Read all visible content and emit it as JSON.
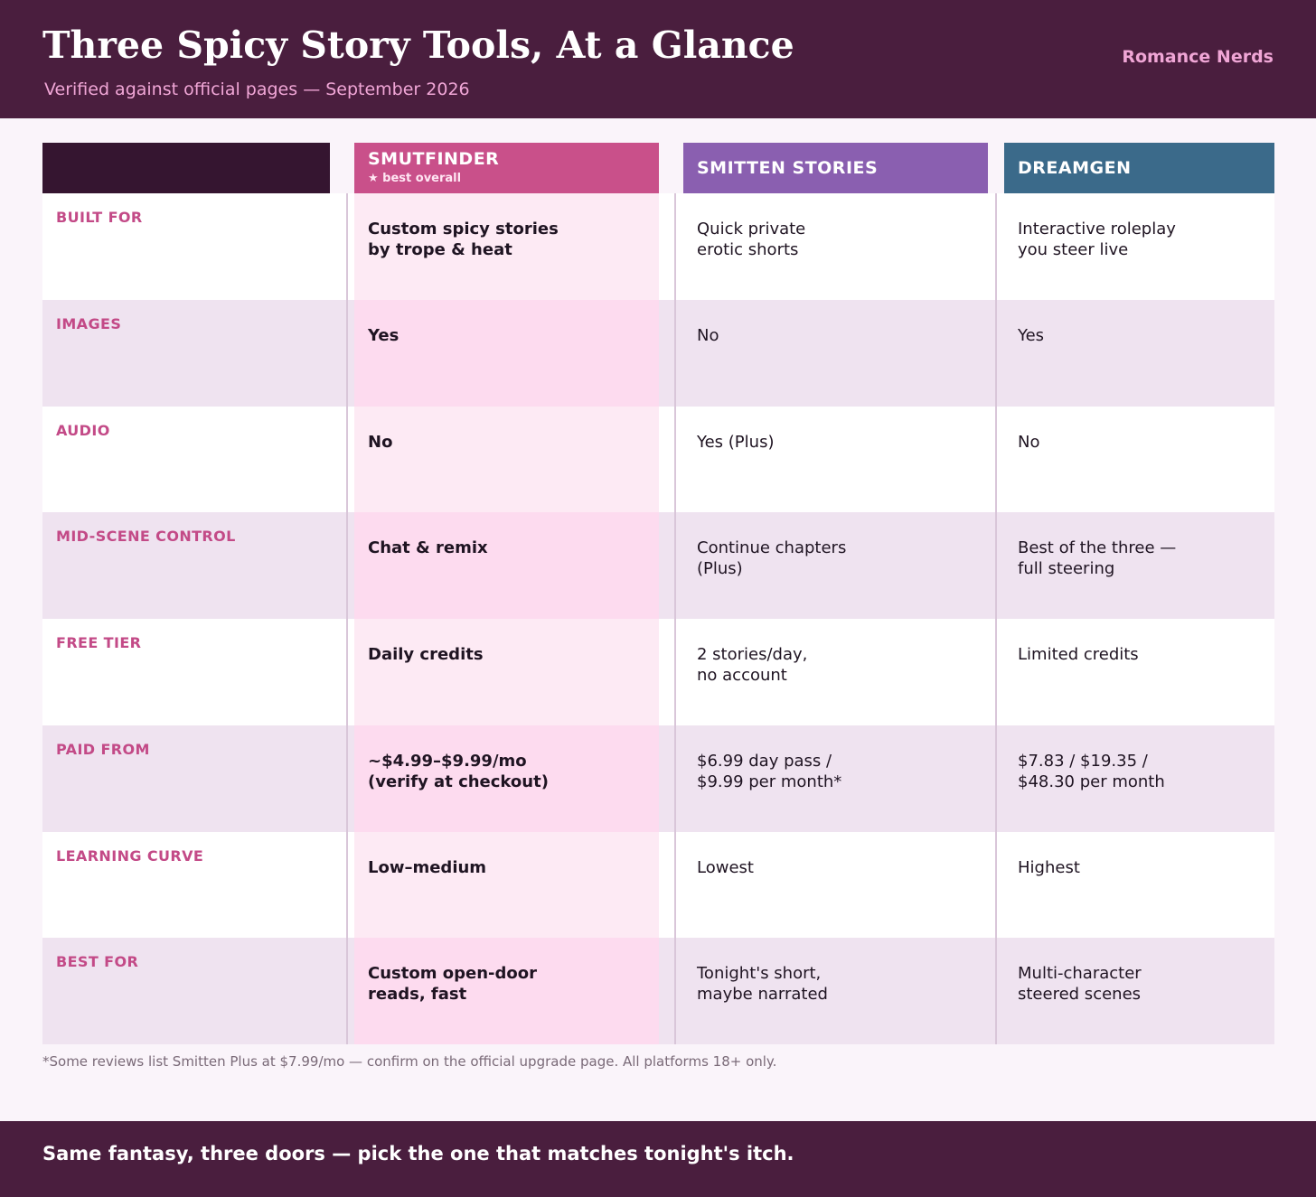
{
  "header": {
    "title": "Three Spicy Story Tools, At a Glance",
    "subtitle": "Verified against official pages — September 2026",
    "brand": "Romance Nerds"
  },
  "columns": [
    {
      "name": "SMUTFINDER",
      "badge": "★ best overall",
      "color": "#c9508a"
    },
    {
      "name": "SMITTEN STORIES",
      "badge": "",
      "color": "#8a5fb0"
    },
    {
      "name": "DREAMGEN",
      "badge": "",
      "color": "#3b6a8a"
    }
  ],
  "colors": {
    "header_bg": "#4a1e3e",
    "label_cell_bg": "#351530",
    "accent": "#c34a87"
  },
  "rows": [
    {
      "label": "BUILT FOR",
      "cells": [
        "Custom spicy stories\nby trope & heat",
        "Quick private\nerotic shorts",
        "Interactive roleplay\nyou steer live"
      ]
    },
    {
      "label": "IMAGES",
      "cells": [
        "Yes",
        "No",
        "Yes"
      ]
    },
    {
      "label": "AUDIO",
      "cells": [
        "No",
        "Yes (Plus)",
        "No"
      ]
    },
    {
      "label": "MID-SCENE CONTROL",
      "cells": [
        "Chat & remix",
        "Continue chapters\n(Plus)",
        "Best of the three —\nfull steering"
      ]
    },
    {
      "label": "FREE TIER",
      "cells": [
        "Daily credits",
        "2 stories/day,\nno account",
        "Limited credits"
      ]
    },
    {
      "label": "PAID FROM",
      "cells": [
        "~$4.99–$9.99/mo\n(verify at checkout)",
        "$6.99 day pass /\n$9.99 per month*",
        "$7.83 / $19.35 /\n$48.30 per month"
      ]
    },
    {
      "label": "LEARNING CURVE",
      "cells": [
        "Low–medium",
        "Lowest",
        "Highest"
      ]
    },
    {
      "label": "BEST FOR",
      "cells": [
        "Custom open-door\nreads, fast",
        "Tonight's short,\nmaybe narrated",
        "Multi-character\nsteered scenes"
      ]
    }
  ],
  "footnote": "*Some reviews list Smitten Plus at $7.99/mo — confirm on the official upgrade page. All platforms 18+ only.",
  "footer": {
    "tagline": "Same fantasy, three doors — pick the one that matches tonight's itch."
  }
}
